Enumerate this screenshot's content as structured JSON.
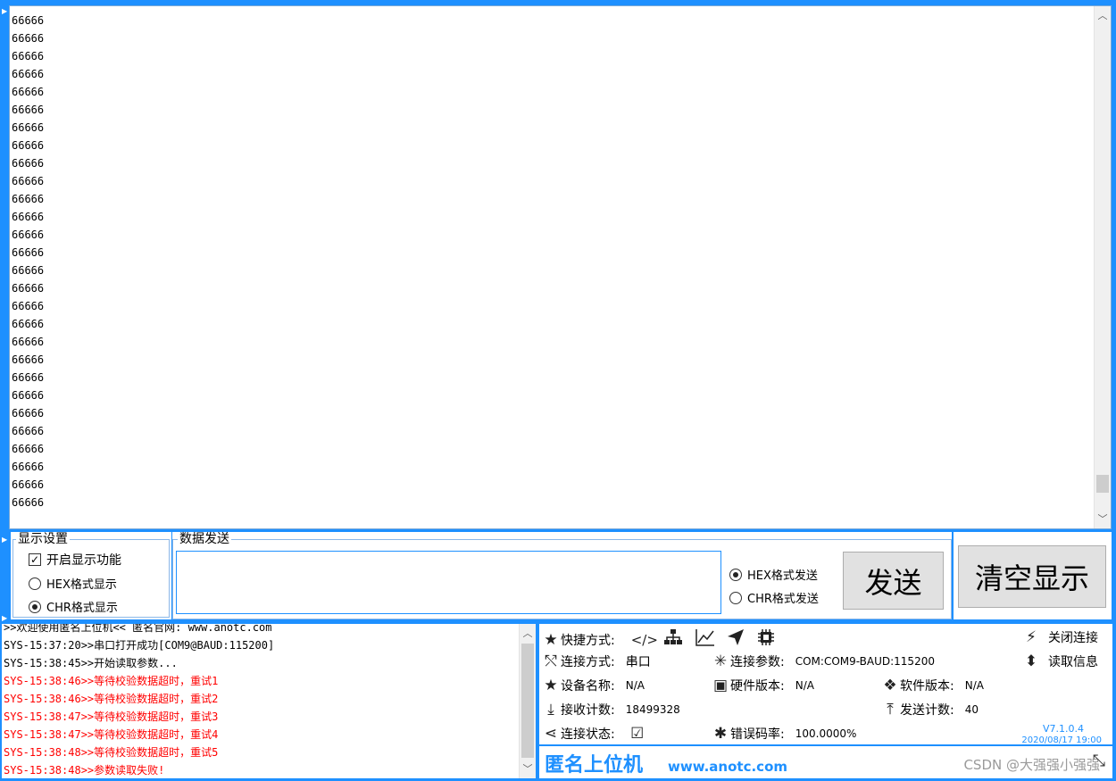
{
  "receive": {
    "lines": [
      "66666",
      "66666",
      "66666",
      "66666",
      "66666",
      "66666",
      "66666",
      "66666",
      "66666",
      "66666",
      "66666",
      "66666",
      "66666",
      "66666",
      "66666",
      "66666",
      "66666",
      "66666",
      "66666",
      "66666",
      "66666",
      "66666",
      "66666",
      "66666",
      "66666",
      "66666",
      "66666",
      "66666"
    ],
    "scroll_position": 0.95
  },
  "display_settings": {
    "title": "显示设置",
    "enable_label": "开启显示功能",
    "enable_checked": true,
    "hex_label": "HEX格式显示",
    "chr_label": "CHR格式显示",
    "selected": "CHR"
  },
  "data_send": {
    "title": "数据发送",
    "input_value": "",
    "hex_label": "HEX格式发送",
    "chr_label": "CHR格式发送",
    "selected": "HEX",
    "send_button": "发送",
    "clear_button": "清空显示"
  },
  "log": {
    "lines": [
      {
        "text": ">>欢迎使用匿名上位机<<   匿名官网: www.anotc.com",
        "color": "#000000"
      },
      {
        "text": "SYS-15:37:20>>串口打开成功[COM9@BAUD:115200]",
        "color": "#000000"
      },
      {
        "text": "SYS-15:38:45>>开始读取参数...",
        "color": "#000000"
      },
      {
        "text": "SYS-15:38:46>>等待校验数据超时，重试1",
        "color": "#ff0000"
      },
      {
        "text": "SYS-15:38:46>>等待校验数据超时，重试2",
        "color": "#ff0000"
      },
      {
        "text": "SYS-15:38:47>>等待校验数据超时，重试3",
        "color": "#ff0000"
      },
      {
        "text": "SYS-15:38:47>>等待校验数据超时，重试4",
        "color": "#ff0000"
      },
      {
        "text": "SYS-15:38:48>>等待校验数据超时，重试5",
        "color": "#ff0000"
      },
      {
        "text": "SYS-15:38:48>>参数读取失败!",
        "color": "#ff0000"
      }
    ]
  },
  "status": {
    "shortcut_label": "快捷方式:",
    "close_conn": "关闭连接",
    "read_info": "读取信息",
    "conn_type_label": "连接方式:",
    "conn_type_value": "串口",
    "conn_param_label": "连接参数:",
    "conn_param_value": "COM:COM9-BAUD:115200",
    "device_label": "设备名称:",
    "device_value": "N/A",
    "hw_label": "硬件版本:",
    "hw_value": "N/A",
    "sw_label": "软件版本:",
    "sw_value": "N/A",
    "rx_label": "接收计数:",
    "rx_value": "18499328",
    "tx_label": "发送计数:",
    "tx_value": "40",
    "state_label": "连接状态:",
    "error_label": "错误码率:",
    "error_value": "100.0000%",
    "version": "V7.1.0.4",
    "date": "2020/08/17 19:00"
  },
  "brand": {
    "name": "匿名上位机",
    "url": "www.anotc.com",
    "watermark": "CSDN @大强强小强强",
    "color": "#1e90ff"
  }
}
